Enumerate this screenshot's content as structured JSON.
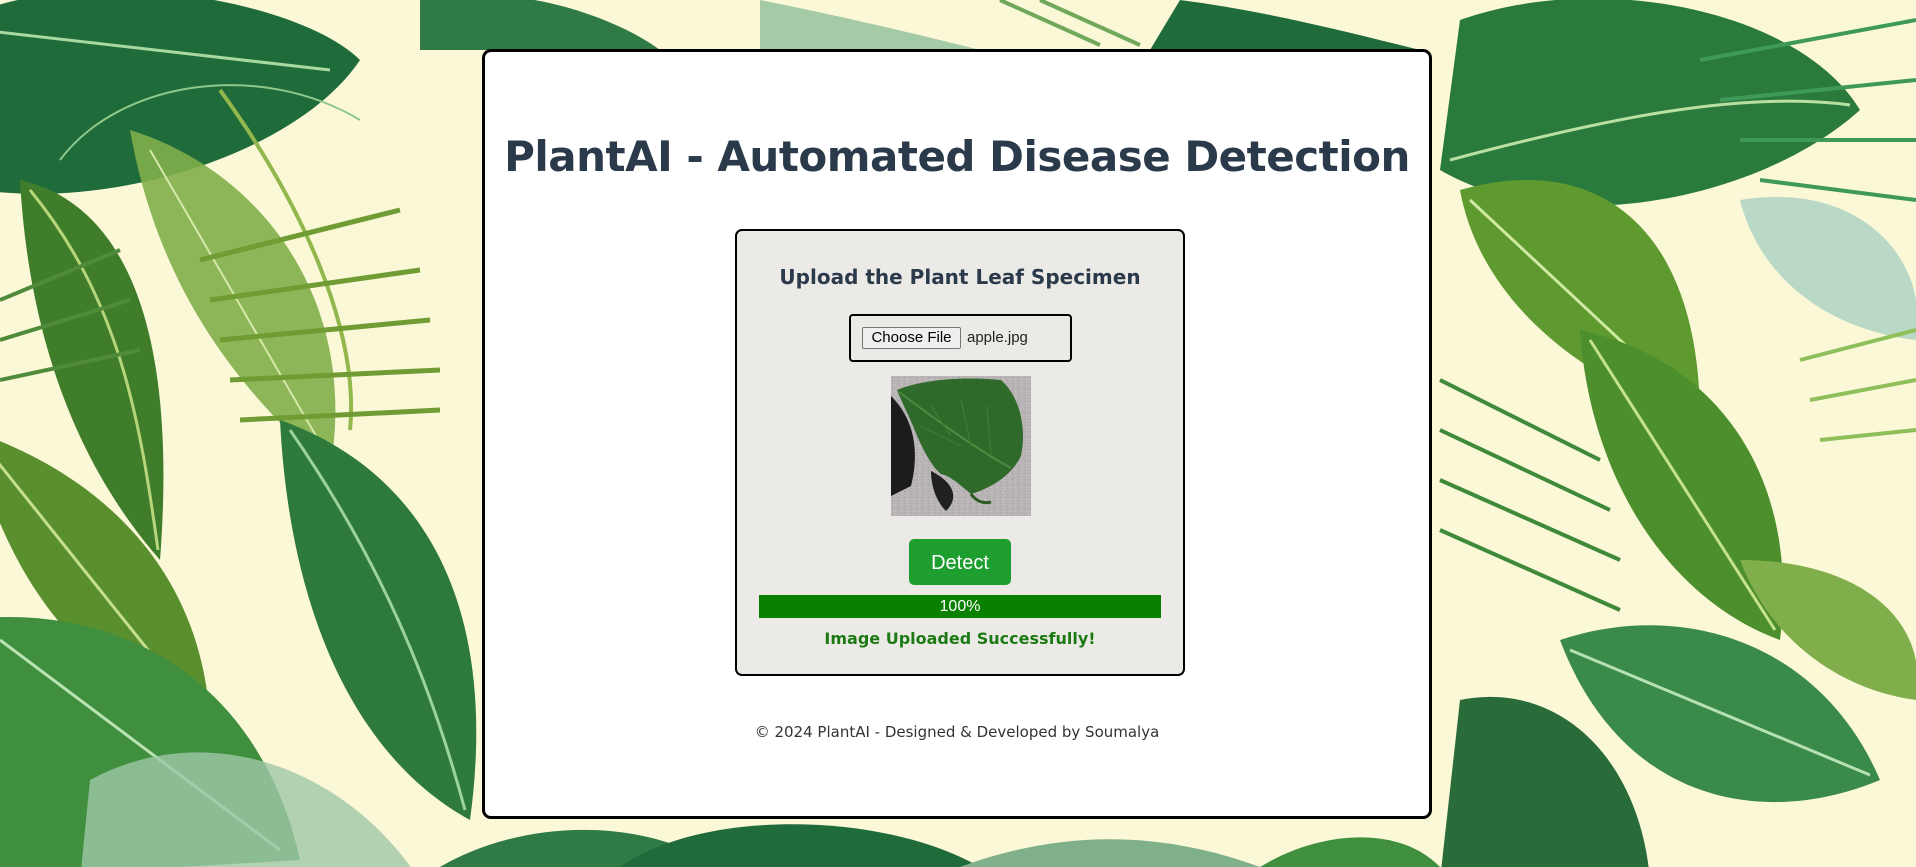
{
  "app": {
    "title": "PlantAI - Automated Disease Detection"
  },
  "upload": {
    "heading": "Upload the Plant Leaf Specimen",
    "choose_file_label": "Choose File",
    "file_name": "apple.jpg"
  },
  "actions": {
    "detect_label": "Detect"
  },
  "progress": {
    "value": 1.0,
    "text": "100%"
  },
  "status": {
    "message": "Image Uploaded Successfully!"
  },
  "footer": {
    "text": "© 2024 PlantAI - Designed & Developed by Soumalya"
  },
  "colors": {
    "background": "#fbf8d8",
    "title": "#2b3a4a",
    "panel": "#eceae6",
    "detect_button": "#1e9e2e",
    "progress_fill": "#0a8000",
    "status_text": "#1c7a14"
  },
  "icons": {
    "background": "tropical-leaves-pattern",
    "preview": "apple-leaf-photo"
  }
}
